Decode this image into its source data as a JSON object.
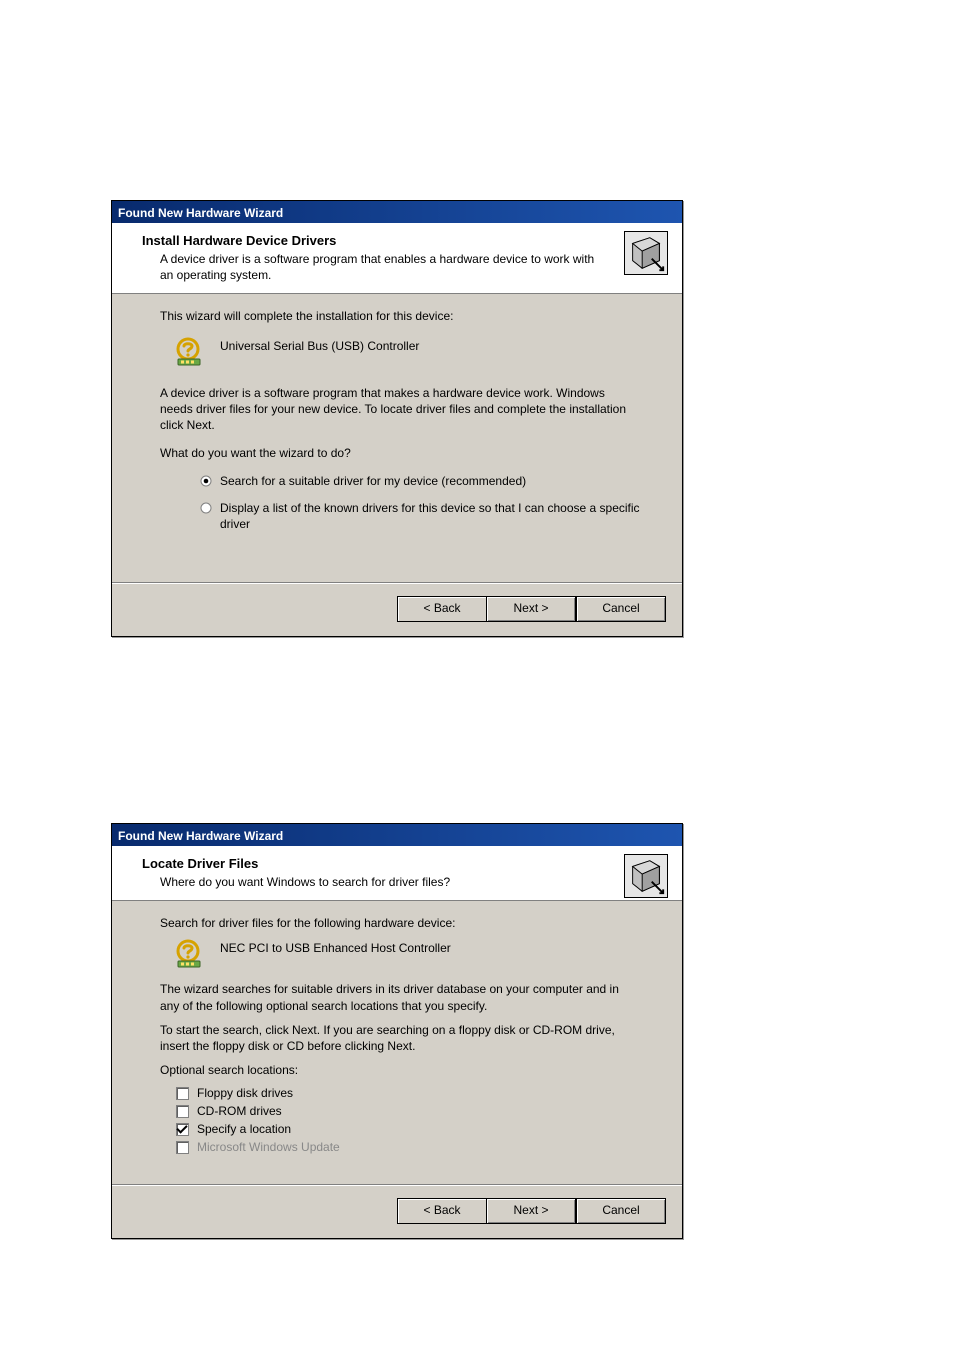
{
  "dialog1": {
    "title": "Found New Hardware Wizard",
    "header": {
      "title": "Install Hardware Device Drivers",
      "subtitle": "A device driver is a software program that enables a hardware device to work with an operating system."
    },
    "body": {
      "intro": "This wizard will complete the installation for this device:",
      "device_name": "Universal Serial Bus (USB) Controller",
      "explain": "A device driver is a software program that makes a hardware device work. Windows needs driver files for your new device. To locate driver files and complete the installation click Next.",
      "question": "What do you want the wizard to do?",
      "options": {
        "search": "Search for a suitable driver for my device (recommended)",
        "display": "Display a list of the known drivers for this device so that I can choose a specific driver"
      }
    },
    "buttons": {
      "back": "< Back",
      "next": "Next >",
      "cancel": "Cancel"
    }
  },
  "dialog2": {
    "title": "Found New Hardware Wizard",
    "header": {
      "title": "Locate Driver Files",
      "subtitle": "Where do you want Windows to search for driver files?"
    },
    "body": {
      "intro": "Search for driver files for the following hardware device:",
      "device_name": "NEC PCI to USB Enhanced Host Controller",
      "explain1": "The wizard searches for suitable drivers in its driver database on your computer and in any of the following optional search locations that you specify.",
      "explain2": "To start the search, click Next. If you are searching on a floppy disk or CD-ROM drive, insert the floppy disk or CD before clicking Next.",
      "optional_label": "Optional search locations:",
      "options": {
        "floppy": "Floppy disk drives",
        "cdrom": "CD-ROM drives",
        "specify": "Specify a location",
        "msupdate": "Microsoft Windows Update"
      }
    },
    "buttons": {
      "back": "< Back",
      "next": "Next >",
      "cancel": "Cancel"
    }
  }
}
